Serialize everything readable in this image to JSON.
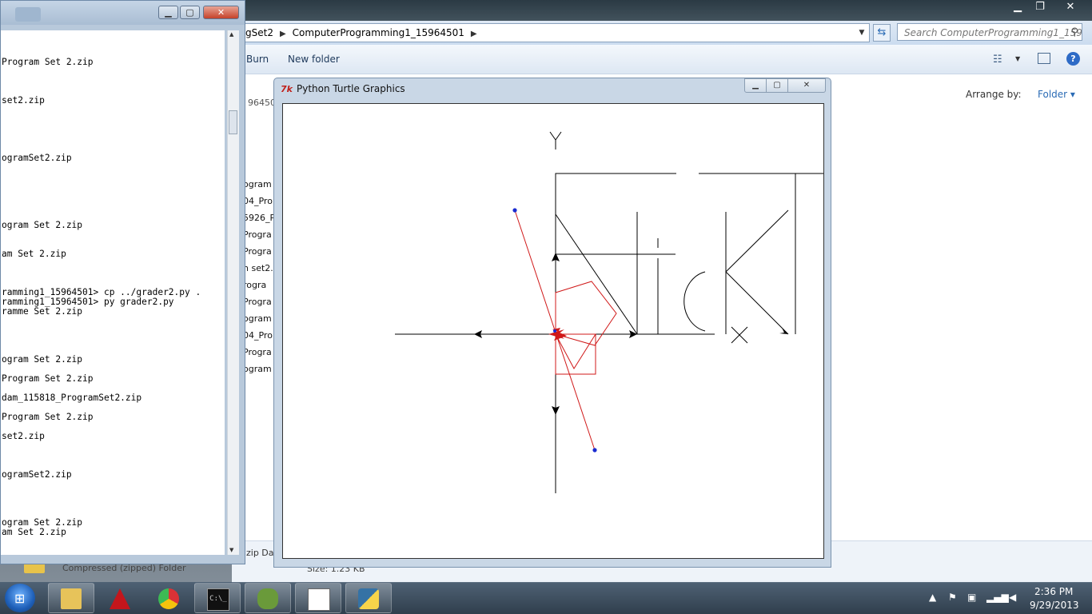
{
  "explorer": {
    "address_parts": [
      "gSet2",
      "ComputerProgramming1_15964501"
    ],
    "search_placeholder": "Search ComputerProgramming1_1596...",
    "cmd_burn": "Burn",
    "cmd_new_folder": "New folder",
    "arrange_label": "Arrange by:",
    "arrange_value": "Folder",
    "breadcrumb_fragment": "964501",
    "file_fragments": [
      "ogram",
      "04_Pro",
      "5926_P",
      "Progra",
      "Progra",
      "n set2.",
      "rogra",
      "Progra",
      "ogram",
      "04_Pro",
      "Progra",
      "ogram"
    ],
    "details_zip": "zip Da",
    "details_type": "Compressed (zipped) Folder",
    "details_size": "Size: 1.23 KB"
  },
  "console": {
    "lines": [
      {
        "text": "Program Set 2.zip",
        "row": 0
      },
      {
        "text": "set2.zip",
        "row": 4
      },
      {
        "text": "ogramSet2.zip",
        "row": 10
      },
      {
        "text": "ogram Set 2.zip",
        "row": 17
      },
      {
        "text": "am Set 2.zip",
        "row": 20
      },
      {
        "text": "ramming1_15964501> cp ../grader2.py .",
        "row": 24
      },
      {
        "text": "ramming1_15964501> py grader2.py",
        "row": 25
      },
      {
        "text": "ramme Set 2.zip",
        "row": 26
      },
      {
        "text": "ogram Set 2.zip",
        "row": 31
      },
      {
        "text": "Program Set 2.zip",
        "row": 33
      },
      {
        "text": "dam_115818_ProgramSet2.zip",
        "row": 35
      },
      {
        "text": "Program Set 2.zip",
        "row": 37
      },
      {
        "text": "set2.zip",
        "row": 39
      },
      {
        "text": "ogramSet2.zip",
        "row": 43
      },
      {
        "text": "ogram Set 2.zip",
        "row": 48
      },
      {
        "text": "am Set 2.zip",
        "row": 49
      }
    ]
  },
  "turtle": {
    "title": "Python Turtle Graphics",
    "axis_label_y": "Y",
    "axis_label_x": "X"
  },
  "taskbar": {
    "time": "2:36 PM",
    "date": "9/29/2013",
    "apps": [
      "explorer-icon",
      "autocad-lt-icon",
      "chrome-icon",
      "cmd-icon",
      "idle-icon",
      "notepad-chart-icon",
      "python-icon"
    ]
  },
  "colors": {
    "turtle_red": "#d01818",
    "dot_blue": "#1a2bd0",
    "link_blue": "#2a6bb5"
  }
}
